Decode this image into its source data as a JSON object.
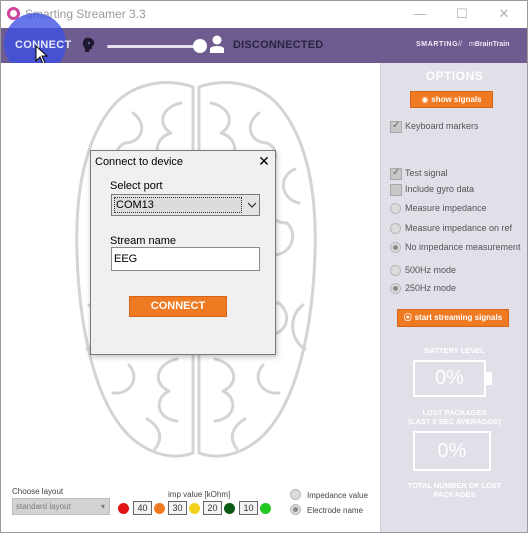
{
  "window": {
    "title": "Smarting Streamer 3.3",
    "minimize_glyph": "—",
    "maximize_glyph": "☐",
    "close_glyph": "✕"
  },
  "header": {
    "connect_label": "CONNECT",
    "status_label": "DISCONNECTED",
    "brand_smarting": "SMARTING",
    "brand_separator": "//",
    "brand_m": "m",
    "brand_braintrain": "BrainTrain",
    "color": "#6e5c91"
  },
  "options": {
    "title": "OPTIONS",
    "show_signals_label": "show signals",
    "keyboard_markers": {
      "label": "Keyboard markers",
      "checked": true
    },
    "test_signal": {
      "label": "Test signal",
      "checked": true
    },
    "include_gyro": {
      "label": "Include gyro data",
      "checked": false
    },
    "impedance_radios": [
      {
        "label": "Measure impedance",
        "selected": false
      },
      {
        "label": "Measure impedance on ref",
        "selected": false
      },
      {
        "label": "No impedance measurement",
        "selected": true
      }
    ],
    "rate_radios": [
      {
        "label": "500Hz mode",
        "selected": false
      },
      {
        "label": "250Hz mode",
        "selected": true
      }
    ],
    "start_streaming_label": "start streaming signals",
    "battery_title": "BATTERY LEVEL",
    "battery_value": "0%",
    "lost_title_line1": "LOST PACKAGES",
    "lost_title_line2": "(LAST 5 SEC AVERAGGE)",
    "lost_value": "0%",
    "total_lost_line1": "TOTAL NUMBER OF LOST",
    "total_lost_line2": "PACKAGES"
  },
  "bottom": {
    "choose_layout_label": "Choose layout",
    "layout_value": "standard layout",
    "imp_label": "imp value [kOhm]",
    "imp_scale": [
      {
        "color": "#e01414",
        "value": "40"
      },
      {
        "color": "#f07a22",
        "value": "30"
      },
      {
        "color": "#f2d21a",
        "value": "20"
      },
      {
        "color": "#0a5a14",
        "value": "10"
      },
      {
        "color": "#22c822",
        "value": ""
      }
    ],
    "display_radios": [
      {
        "label": "Impedance value",
        "selected": false
      },
      {
        "label": "Electrode name",
        "selected": true
      }
    ]
  },
  "dialog": {
    "title": "Connect to device",
    "close_glyph": "✕",
    "select_port_label": "Select port",
    "port_value": "COM13",
    "stream_name_label": "Stream name",
    "stream_name_value": "EEG",
    "connect_button_label": "CONNECT"
  },
  "accent": "#f07a22"
}
